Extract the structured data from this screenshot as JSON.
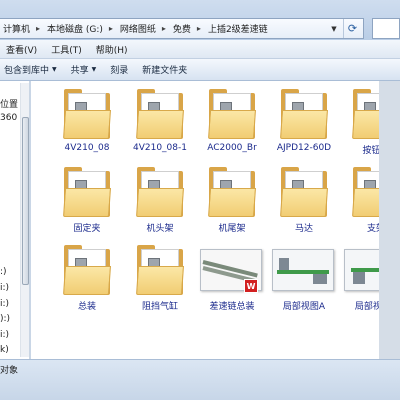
{
  "address": {
    "crumbs": [
      "计算机",
      "本地磁盘 (G:)",
      "网络图纸",
      "免费",
      "上插2级差速链"
    ]
  },
  "menu": [
    "查看(V)",
    "工具(T)",
    "帮助(H)"
  ],
  "commands": {
    "include_library": "包含到库中",
    "share": "共享",
    "burn": "刻录",
    "new_folder": "新建文件夹"
  },
  "nav": {
    "items": [
      "位置",
      "360",
      ":)",
      "i:)",
      "i:)",
      "):)",
      "i:)",
      "k)"
    ]
  },
  "files": [
    {
      "name": "4V210_08",
      "kind": "folder"
    },
    {
      "name": "4V210_08-1",
      "kind": "folder"
    },
    {
      "name": "AC2000_Br",
      "kind": "folder"
    },
    {
      "name": "AJPD12-60D",
      "kind": "folder"
    },
    {
      "name": "按钮盒",
      "kind": "folder"
    },
    {
      "name": "固定夹",
      "kind": "folder"
    },
    {
      "name": "机头架",
      "kind": "folder"
    },
    {
      "name": "机尾架",
      "kind": "folder"
    },
    {
      "name": "马达",
      "kind": "folder"
    },
    {
      "name": "支架",
      "kind": "folder"
    },
    {
      "name": "总装",
      "kind": "folder"
    },
    {
      "name": "阻挡气缸",
      "kind": "folder"
    },
    {
      "name": "差速链总装",
      "kind": "solidworks-file"
    },
    {
      "name": "局部视图A",
      "kind": "image"
    },
    {
      "name": "局部视图B",
      "kind": "image"
    }
  ],
  "status": {
    "text": "对象"
  },
  "colors": {
    "folder": "#f1cd73",
    "label": "#1b2a8c",
    "chrome": "#c9d6e6"
  }
}
